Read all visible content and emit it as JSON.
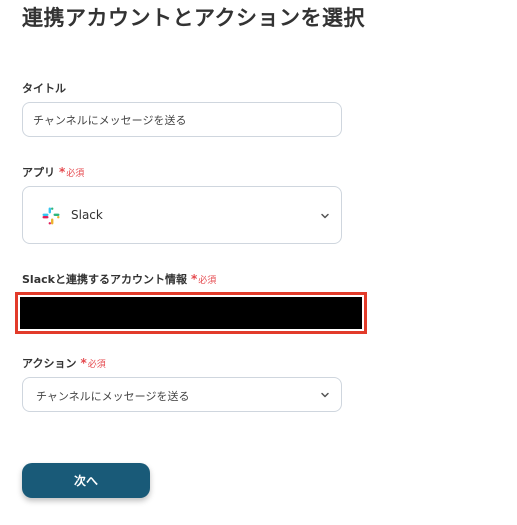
{
  "page": {
    "title": "連携アカウントとアクションを選択"
  },
  "fields": {
    "title_field": {
      "label": "タイトル",
      "value": "チャンネルにメッセージを送る"
    },
    "app_field": {
      "label": "アプリ",
      "required_mark": "*",
      "required_text": "必須",
      "selected_app": "Slack",
      "icon": "slack-logo-icon"
    },
    "account_field": {
      "label": "Slackと連携するアカウント情報",
      "required_mark": "*",
      "required_text": "必須"
    },
    "action_field": {
      "label": "アクション",
      "required_mark": "*",
      "required_text": "必須",
      "selected_action": "チャンネルにメッセージを送る"
    }
  },
  "buttons": {
    "next_label": "次へ"
  },
  "colors": {
    "primary_button": "#195a78",
    "required": "#e5484d",
    "redaction_border": "#e23b2a",
    "redaction_fill": "#000000",
    "input_border": "#cfd6de"
  }
}
